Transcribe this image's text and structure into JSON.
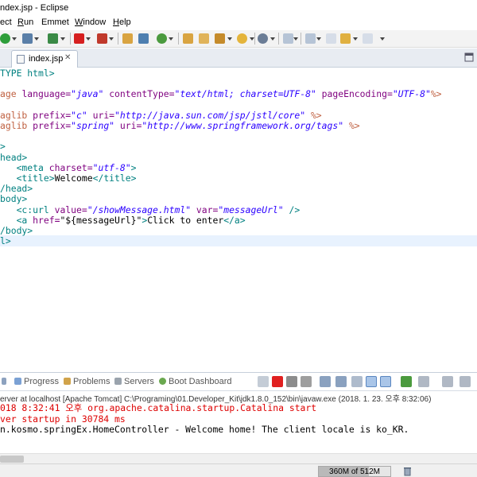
{
  "window": {
    "title": "ndex.jsp - Eclipse"
  },
  "menu": {
    "items": [
      "ect",
      "Run",
      "Emmet",
      "Window",
      "Help"
    ],
    "underline": [
      "",
      "R",
      "",
      "W",
      "H"
    ]
  },
  "toolbar": {
    "icons": [
      "run-icon",
      "debug-icon",
      "external-tools-icon",
      "stop-icon",
      "server-icon",
      "search-icon",
      "open-type-icon",
      "open-folder-icon",
      "refresh-icon",
      "settings-icon",
      "next-annotation-icon",
      "prev-annotation-icon",
      "back-icon",
      "forward-icon"
    ]
  },
  "editor": {
    "tab_label": "index.jsp",
    "lines": [
      [
        {
          "c": "t",
          "s": "TYPE html>"
        }
      ],
      [],
      [
        {
          "c": "dir",
          "s": "age "
        },
        {
          "c": "an",
          "s": "language="
        },
        {
          "c": "av",
          "s": "\"java\""
        },
        {
          "c": "tx",
          "s": " "
        },
        {
          "c": "an",
          "s": "contentType="
        },
        {
          "c": "av",
          "s": "\"text/html; charset=UTF-8\""
        },
        {
          "c": "tx",
          "s": " "
        },
        {
          "c": "an",
          "s": "pageEncoding="
        },
        {
          "c": "av",
          "s": "\"UTF-8\""
        },
        {
          "c": "dir",
          "s": "%>"
        }
      ],
      [],
      [
        {
          "c": "dir",
          "s": "aglib "
        },
        {
          "c": "an",
          "s": "prefix="
        },
        {
          "c": "av",
          "s": "\"c\""
        },
        {
          "c": "tx",
          "s": " "
        },
        {
          "c": "an",
          "s": "uri="
        },
        {
          "c": "av",
          "s": "\"http://java.sun.com/jsp/jstl/core\""
        },
        {
          "c": "tx",
          "s": " "
        },
        {
          "c": "dir",
          "s": "%>"
        }
      ],
      [
        {
          "c": "dir",
          "s": "aglib "
        },
        {
          "c": "an",
          "s": "prefix="
        },
        {
          "c": "av",
          "s": "\"spring\""
        },
        {
          "c": "tx",
          "s": " "
        },
        {
          "c": "an",
          "s": "uri="
        },
        {
          "c": "av",
          "s": "\"http://www.springframework.org/tags\""
        },
        {
          "c": "tx",
          "s": " "
        },
        {
          "c": "dir",
          "s": "%>"
        }
      ],
      [],
      [
        {
          "c": "t",
          "s": ">"
        }
      ],
      [
        {
          "c": "t",
          "s": "head>"
        }
      ],
      [
        {
          "c": "tx",
          "s": "   "
        },
        {
          "c": "t",
          "s": "<meta "
        },
        {
          "c": "an",
          "s": "charset="
        },
        {
          "c": "av",
          "s": "\"utf-8\""
        },
        {
          "c": "t",
          "s": ">"
        }
      ],
      [
        {
          "c": "tx",
          "s": "   "
        },
        {
          "c": "t",
          "s": "<title>"
        },
        {
          "c": "tx",
          "s": "Welcome"
        },
        {
          "c": "t",
          "s": "</title>"
        }
      ],
      [
        {
          "c": "t",
          "s": "/head>"
        }
      ],
      [
        {
          "c": "t",
          "s": "body>"
        }
      ],
      [
        {
          "c": "tx",
          "s": "   "
        },
        {
          "c": "t",
          "s": "<c:url "
        },
        {
          "c": "an",
          "s": "value="
        },
        {
          "c": "av",
          "s": "\"/showMessage.html\""
        },
        {
          "c": "tx",
          "s": " "
        },
        {
          "c": "an",
          "s": "var="
        },
        {
          "c": "av",
          "s": "\"messageUrl\""
        },
        {
          "c": "tx",
          "s": " "
        },
        {
          "c": "t",
          "s": "/>"
        }
      ],
      [
        {
          "c": "tx",
          "s": "   "
        },
        {
          "c": "t",
          "s": "<a "
        },
        {
          "c": "an",
          "s": "href="
        },
        {
          "c": "tx",
          "s": "\"${messageUrl}\""
        },
        {
          "c": "t",
          "s": ">"
        },
        {
          "c": "tx",
          "s": "Click to enter"
        },
        {
          "c": "t",
          "s": "</a>"
        }
      ],
      [
        {
          "c": "t",
          "s": "/body>"
        }
      ],
      [
        {
          "c": "t",
          "s": "l>"
        }
      ]
    ]
  },
  "panel": {
    "tabs": [
      "Progress",
      "Problems",
      "Servers",
      "Boot Dashboard"
    ],
    "console_header": "erver at localhost [Apache Tomcat] C:\\Programing\\01.Developer_Kit\\jdk1.8.0_152\\bin\\javaw.exe (2018. 1. 23. 오후 8:32:06)",
    "console_lines": [
      {
        "cls": "err",
        "text": "018 8:32:41 오후 org.apache.catalina.startup.Catalina start"
      },
      {
        "cls": "err",
        "text": "ver startup in 30784 ms"
      },
      {
        "cls": "norm",
        "text": "n.kosmo.springEx.HomeController - Welcome home! The client locale is ko_KR."
      }
    ]
  },
  "status": {
    "heap": "360M of 512M",
    "heap_used_fraction": 0.703
  },
  "colors": {
    "tag": "#008080",
    "attr_name": "#7f007f",
    "attr_value": "#2a00ff",
    "error": "#dd0000"
  }
}
